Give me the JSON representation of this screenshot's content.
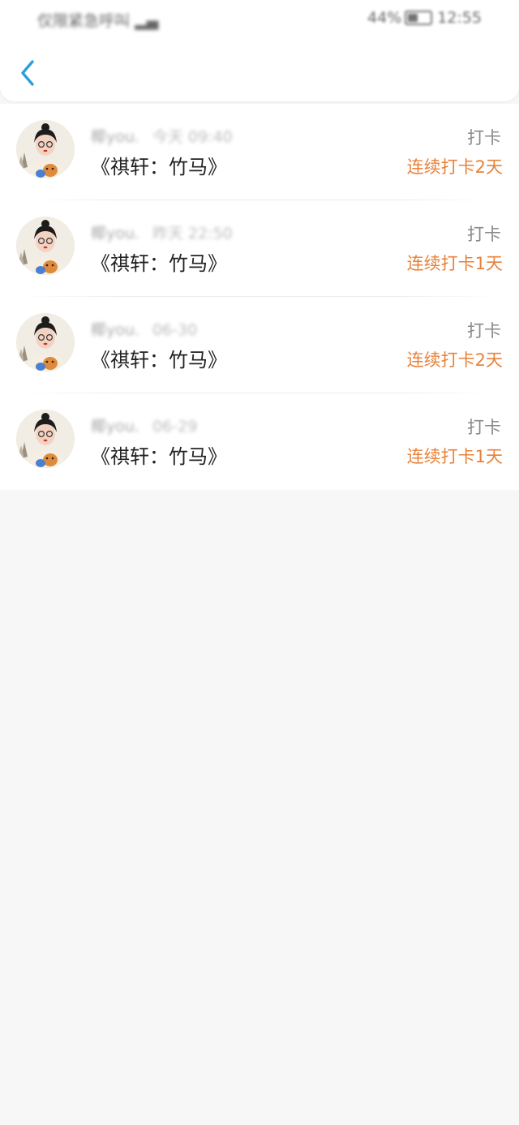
{
  "status_bar": {
    "left_text": "仅限紧急呼叫",
    "battery": "44%",
    "time": "12:55"
  },
  "header": {
    "back_icon": "chevron-left-icon",
    "accent": "#2a9fdb"
  },
  "list": {
    "items": [
      {
        "user": "椰you.",
        "time": "今天 09:40",
        "title": "《祺轩：竹马》",
        "tag": "打卡",
        "streak": "连续打卡2天"
      },
      {
        "user": "椰you.",
        "time": "昨天 22:50",
        "title": "《祺轩：竹马》",
        "tag": "打卡",
        "streak": "连续打卡1天"
      },
      {
        "user": "椰you.",
        "time": "06-30",
        "title": "《祺轩：竹马》",
        "tag": "打卡",
        "streak": "连续打卡2天"
      },
      {
        "user": "椰you.",
        "time": "06-29",
        "title": "《祺轩：竹马》",
        "tag": "打卡",
        "streak": "连续打卡1天"
      }
    ]
  },
  "colors": {
    "streak": "#e8823a",
    "background": "#f8f7f8"
  }
}
